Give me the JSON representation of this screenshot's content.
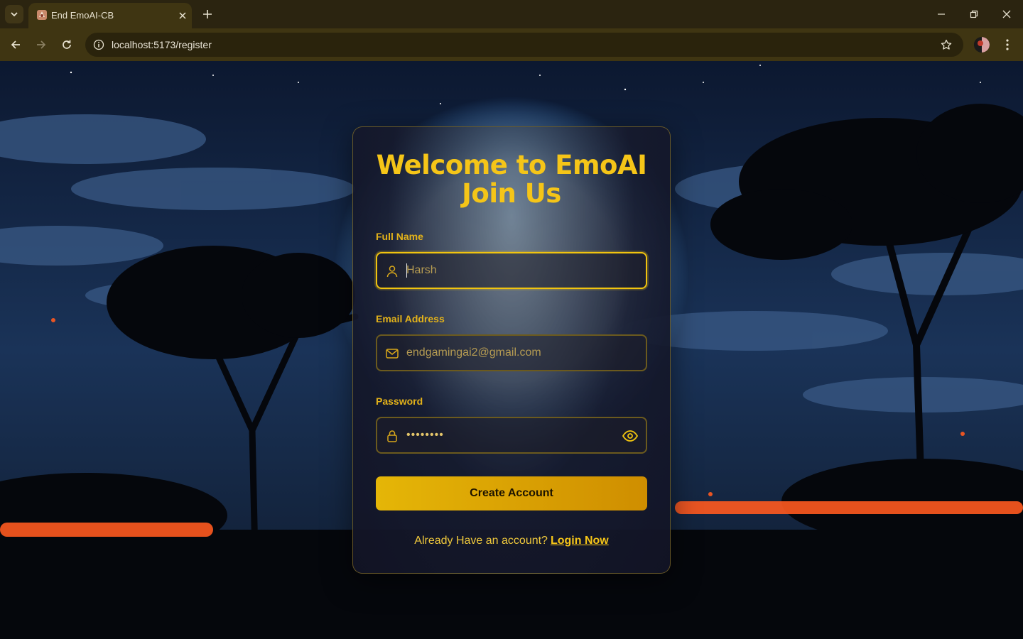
{
  "browser": {
    "tab_title": "End EmoAI-CB",
    "url": "localhost:5173/register"
  },
  "card": {
    "title_line1": "Welcome to EmoAI",
    "title_line2": "Join Us",
    "full_name": {
      "label": "Full Name",
      "placeholder": "Harsh",
      "value": ""
    },
    "email": {
      "label": "Email Address",
      "placeholder": "endgamingai2@gmail.com",
      "value": ""
    },
    "password": {
      "label": "Password",
      "masked_value": "••••••••"
    },
    "submit_label": "Create Account",
    "footer_text": "Already Have an account?",
    "footer_link": "Login Now"
  },
  "colors": {
    "accent": "#f5c518",
    "button_start": "#e5b607",
    "button_end": "#cf8e00",
    "chrome": "#3f3512"
  },
  "icons": [
    "chevron-down-icon",
    "favicon-icon",
    "close-icon",
    "plus-icon",
    "minimize-icon",
    "restore-icon",
    "window-close-icon",
    "back-icon",
    "forward-icon",
    "reload-icon",
    "site-info-icon",
    "star-icon",
    "menu-icon",
    "user-icon",
    "mail-icon",
    "lock-icon",
    "eye-icon"
  ]
}
